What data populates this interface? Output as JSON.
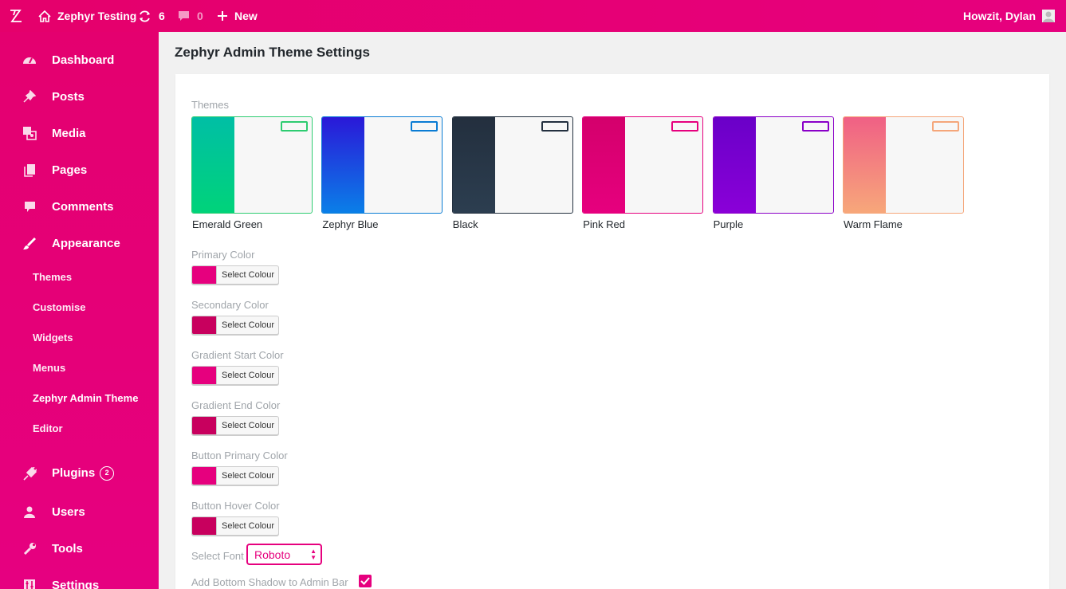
{
  "adminbar": {
    "logo": "zephyr-logo",
    "site_name": "Zephyr Testing",
    "updates_count": "6",
    "comments_count": "0",
    "new_label": "New",
    "greeting": "Howzit, Dylan"
  },
  "sidebar": {
    "items": [
      {
        "label": "Dashboard",
        "icon": "dashboard-icon"
      },
      {
        "label": "Posts",
        "icon": "pin-icon"
      },
      {
        "label": "Media",
        "icon": "media-icon"
      },
      {
        "label": "Pages",
        "icon": "pages-icon"
      },
      {
        "label": "Comments",
        "icon": "comments-icon"
      },
      {
        "label": "Appearance",
        "icon": "brush-icon"
      }
    ],
    "submenu": [
      "Themes",
      "Customise",
      "Widgets",
      "Menus",
      "Zephyr Admin Theme",
      "Editor"
    ],
    "items_lower": [
      {
        "label": "Plugins",
        "icon": "plugin-icon",
        "badge": "2"
      },
      {
        "label": "Users",
        "icon": "user-icon"
      },
      {
        "label": "Tools",
        "icon": "wrench-icon"
      },
      {
        "label": "Settings",
        "icon": "settings-icon"
      }
    ]
  },
  "main": {
    "title": "Zephyr Admin Theme Settings",
    "themes_label": "Themes",
    "themes": [
      {
        "name": "Emerald Green",
        "border": "#2ecc71",
        "bar_top": "#00bfa5",
        "bar_bottom": "#00d37a"
      },
      {
        "name": "Zephyr Blue",
        "border": "#0a7cd4",
        "bar_top": "#2a18d8",
        "bar_bottom": "#0a7fe8"
      },
      {
        "name": "Black",
        "border": "#23303f",
        "bar_top": "#232f3e",
        "bar_bottom": "#2c3e50"
      },
      {
        "name": "Pink Red",
        "border": "#e6007e",
        "bar_top": "#d4006c",
        "bar_bottom": "#e6007e"
      },
      {
        "name": "Purple",
        "border": "#8a00c8",
        "bar_top": "#6a00c8",
        "bar_bottom": "#8a00d8"
      },
      {
        "name": "Warm Flame",
        "border": "#f5a67a",
        "bar_top": "#f06085",
        "bar_bottom": "#f7a77a"
      }
    ],
    "colour_fields": [
      {
        "label": "Primary Color",
        "button": "Select Colour",
        "swatch": "#e6007e"
      },
      {
        "label": "Secondary Color",
        "button": "Select Colour",
        "swatch": "#c8005e"
      },
      {
        "label": "Gradient Start Color",
        "button": "Select Colour",
        "swatch": "#e6007e"
      },
      {
        "label": "Gradient End Color",
        "button": "Select Colour",
        "swatch": "#c8005e"
      },
      {
        "label": "Button Primary Color",
        "button": "Select Colour",
        "swatch": "#e6007e"
      },
      {
        "label": "Button Hover Color",
        "button": "Select Colour",
        "swatch": "#c8005e"
      }
    ],
    "font_label": "Select Font",
    "font_value": "Roboto",
    "shadow_label": "Add Bottom Shadow to Admin Bar",
    "shadow_checked": true
  }
}
